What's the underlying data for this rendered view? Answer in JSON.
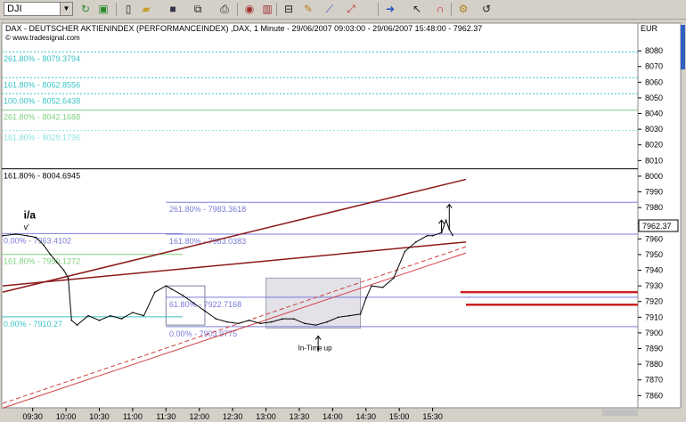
{
  "toolbar": {
    "symbol": "DJI",
    "icons": [
      "refresh-icon",
      "save-green-icon",
      "new-page-icon",
      "open-folder-icon",
      "save-icon",
      "copy-icon",
      "print-icon",
      "binoculars-icon",
      "bar-chart-icon",
      "indicator-icon",
      "drawing-icon",
      "fibonacci-icon",
      "arrow-right-icon",
      "cursor-icon",
      "magnet-icon",
      "settings-icon",
      "reload-icon"
    ]
  },
  "header": {
    "title": "DAX - DEUTSCHER AKTIENINDEX (PERFORMANCEINDEX) ,DAX, 1 Minute - 29/06/2007 09:03:00 - 29/06/2007 15:48:00 - 7962.37",
    "source": "© www.tradesignal.com"
  },
  "chart_data": {
    "type": "line",
    "title": "DAX - DEUTSCHER AKTIENINDEX (PERFORMANCEINDEX) ,DAX, 1 Minute - 29/06/2007 09:03:00 - 29/06/2007 15:48:00 - 7962.37",
    "currency_label": "EUR",
    "ylim": [
      7852,
      8092
    ],
    "y_ticks": [
      7860,
      7870,
      7880,
      7890,
      7900,
      7910,
      7920,
      7930,
      7940,
      7950,
      7960,
      7970,
      7980,
      7990,
      8000,
      8010,
      8020,
      8030,
      8040,
      8050,
      8060,
      8070,
      8080
    ],
    "x_ticks": [
      "09:30",
      "10:00",
      "10:30",
      "11:00",
      "11:30",
      "12:00",
      "12:30",
      "13:00",
      "13:30",
      "14:00",
      "14:30",
      "15:00",
      "15:30"
    ],
    "last_price": "7962.37",
    "series": [
      {
        "x": [
          "09:03",
          "09:15",
          "09:25",
          "09:33",
          "09:40",
          "09:46",
          "09:52",
          "09:58",
          "10:02",
          "10:05",
          "10:10",
          "10:20",
          "10:30",
          "10:40",
          "10:50",
          "11:00",
          "11:10",
          "11:20",
          "11:30",
          "11:35",
          "11:45",
          "11:55",
          "12:05",
          "12:15",
          "12:25",
          "12:35",
          "12:45",
          "12:55",
          "13:05",
          "13:15",
          "13:25",
          "13:35",
          "13:45",
          "13:55",
          "14:05",
          "14:15",
          "14:25",
          "14:30",
          "14:35",
          "14:45",
          "14:55",
          "15:05",
          "15:15",
          "15:25",
          "15:30",
          "15:38",
          "15:42",
          "15:45",
          "15:48"
        ],
        "y": [
          7962,
          7963,
          7962,
          7961,
          7956,
          7950,
          7945,
          7940,
          7935,
          7908,
          7905,
          7911,
          7908,
          7911,
          7909,
          7913,
          7911,
          7926,
          7930,
          7928,
          7924,
          7919,
          7914,
          7909,
          7907,
          7906,
          7908,
          7906,
          7907,
          7909,
          7909,
          7906,
          7905,
          7907,
          7910,
          7911,
          7912,
          7922,
          7930,
          7929,
          7935,
          7952,
          7958,
          7962,
          7962,
          7964,
          7972,
          7966,
          7962.37
        ]
      }
    ],
    "fib_levels": [
      {
        "label": "261.80% - 8079.3794",
        "value": 8079.38,
        "color": "#39c3c3",
        "group": "upper"
      },
      {
        "label": "161.80% - 8062.8556",
        "value": 8062.86,
        "color": "#39c3c3",
        "group": "upper"
      },
      {
        "label": "100.00% - 8052.6438",
        "value": 8052.64,
        "color": "#39c3c3",
        "group": "upper"
      },
      {
        "label": "261.80% - 8042.1688",
        "value": 8042.17,
        "color": "#7ed07e",
        "group": "upper"
      },
      {
        "label": "161.80% - 8029.1796",
        "value": 8029.18,
        "color": "#8fe0e0",
        "group": "upper"
      },
      {
        "label": "161.80% - 8004.6945",
        "value": 8004.69,
        "color": "#000000",
        "group": "upper"
      },
      {
        "label": "0.00% - 7963.4102",
        "value": 7963.41,
        "color": "#7a7ad8",
        "group": "left"
      },
      {
        "label": "161.80% - 7950.1272",
        "value": 7950.13,
        "color": "#7ed07e",
        "group": "left"
      },
      {
        "label": "0.00% - 7910.27",
        "value": 7910.27,
        "color": "#39c3c3",
        "group": "left"
      },
      {
        "label": "261.80% - 7983.3618",
        "value": 7983.36,
        "color": "#7a7ad8",
        "group": "mid"
      },
      {
        "label": "161.80% - 7963.0383",
        "value": 7963.04,
        "color": "#7a7ad8",
        "group": "mid"
      },
      {
        "label": "61.80% - 7922.7168",
        "value": 7922.72,
        "color": "#7a7ad8",
        "group": "mid"
      },
      {
        "label": "0.00% - 7903.9775",
        "value": 7903.98,
        "color": "#7a7ad8",
        "group": "mid"
      }
    ],
    "annotations": [
      {
        "text": "i/a",
        "x": "09:30",
        "y": 7973
      },
      {
        "text": "v'",
        "x": "09:30",
        "y": 7966
      },
      {
        "text": "In-Time up",
        "x": "13:45",
        "y": 7889
      }
    ]
  }
}
